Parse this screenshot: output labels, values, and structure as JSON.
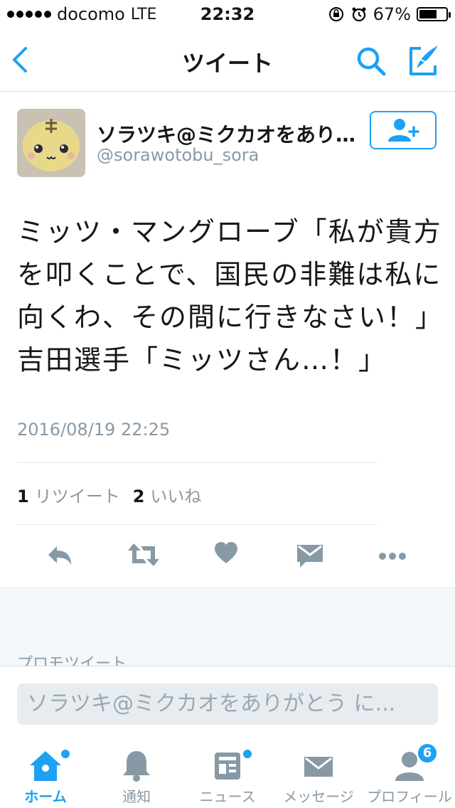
{
  "status_bar": {
    "carrier": "docomo",
    "network": "LTE",
    "time": "22:32",
    "battery_text": "67%",
    "battery_level": 0.67
  },
  "nav": {
    "title": "ツイート",
    "back_icon": "chevron-left-icon",
    "search_icon": "search-icon",
    "compose_icon": "compose-icon",
    "accent": "#1da1f2"
  },
  "tweet": {
    "display_name": "ソラツキ@ミクカオをあり…",
    "handle": "@sorawotobu_sora",
    "text": "ミッツ・マングローブ「私が貴方を叩くことで、国民の非難は私に向くわ、その間に行きなさい！」\n吉田選手「ミッツさん…！」",
    "timestamp": "2016/08/19 22:25",
    "retweet_count": "1",
    "retweet_label": "リツイート",
    "like_count": "2",
    "like_label": "いいね"
  },
  "promo": {
    "label": "プロモツイート"
  },
  "reply": {
    "placeholder": "ソラツキ@ミクカオをありがとう に..."
  },
  "tabs": [
    {
      "label": "ホーム",
      "icon": "home-icon",
      "active": true
    },
    {
      "label": "通知",
      "icon": "bell-icon"
    },
    {
      "label": "ニュース",
      "icon": "news-icon"
    },
    {
      "label": "メッセージ",
      "icon": "envelope-icon"
    },
    {
      "label": "プロフィール",
      "icon": "profile-icon",
      "badge": "6"
    }
  ]
}
